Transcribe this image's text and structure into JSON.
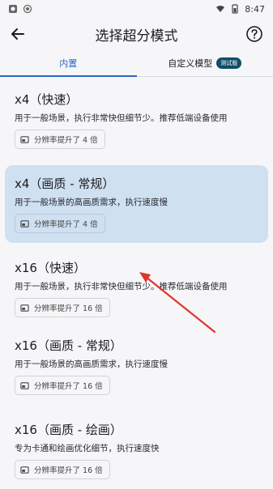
{
  "status": {
    "time": "8:47"
  },
  "header": {
    "title": "选择超分模式"
  },
  "tabs": [
    {
      "label": "内置"
    },
    {
      "label": "自定义模型",
      "badge": "测试版"
    }
  ],
  "models": [
    {
      "name": "x4（快速）",
      "desc": "用于一般场景，执行非常快但细节少。推荐低端设备使用",
      "chip": "分辨率提升了 4 倍"
    },
    {
      "name": "x4（画质 - 常规）",
      "desc": "用于一般场景的高画质需求，执行速度慢",
      "chip": "分辨率提升了 4 倍"
    },
    {
      "name": "x16（快速）",
      "desc": "用于一般场景，执行非常快但细节少。推荐低端设备使用",
      "chip": "分辨率提升了 16 倍"
    },
    {
      "name": "x16（画质 - 常规）",
      "desc": "用于一般场景的高画质需求，执行速度慢",
      "chip": "分辨率提升了 16 倍"
    },
    {
      "name": "x16（画质 - 绘画）",
      "desc": "专为卡通和绘画优化细节，执行速度快",
      "chip": "分辨率提升了 16 倍"
    }
  ],
  "colors": {
    "accent": "#2b66c8",
    "selected_card": "#cfe0f1",
    "badge": "#0e4e66",
    "annotation_arrow": "#e0352b"
  }
}
